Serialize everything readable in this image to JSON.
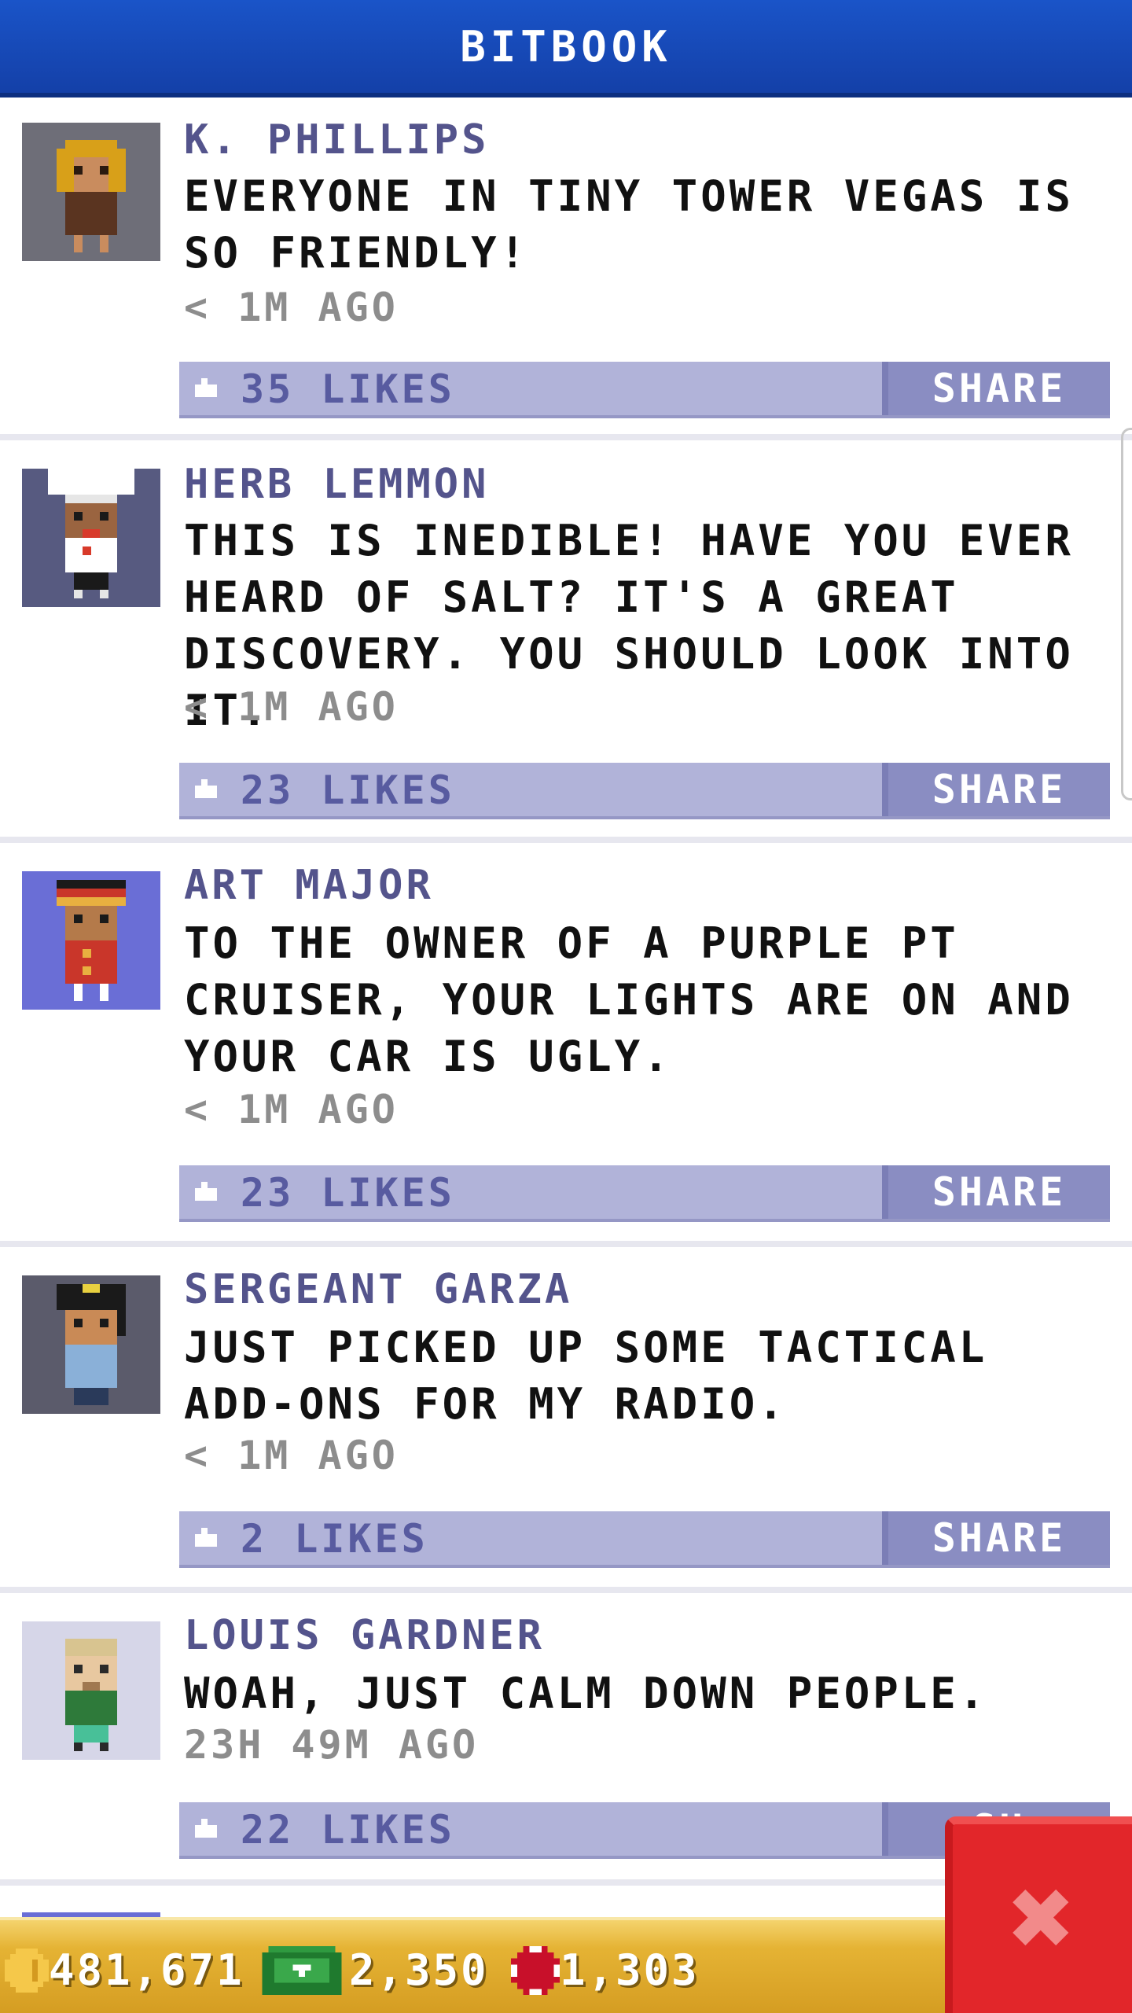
{
  "header": {
    "title": "BITBOOK"
  },
  "posts": [
    {
      "author": "K. PHILLIPS",
      "message": "EVERYONE IN TINY TOWER VEGAS IS SO FRIENDLY!",
      "time": "< 1M AGO",
      "likes": "35 LIKES",
      "share": "SHARE",
      "avatar_bg": "#6e6e78"
    },
    {
      "author": "HERB LEMMON",
      "message": "THIS IS INEDIBLE! HAVE YOU EVER HEARD OF SALT? IT'S A GREAT DISCOVERY. YOU SHOULD LOOK INTO IT.",
      "time": "< 1M AGO",
      "likes": "23 LIKES",
      "share": "SHARE",
      "avatar_bg": "#575a80"
    },
    {
      "author": "ART MAJOR",
      "message": "TO THE OWNER OF A PURPLE PT CRUISER, YOUR LIGHTS ARE ON AND YOUR CAR IS UGLY.",
      "time": "< 1M AGO",
      "likes": "23 LIKES",
      "share": "SHARE",
      "avatar_bg": "#6a6ed6"
    },
    {
      "author": "SERGEANT GARZA",
      "message": "JUST PICKED UP SOME TACTICAL ADD-ONS FOR MY RADIO.",
      "time": "< 1M AGO",
      "likes": "2 LIKES",
      "share": "SHARE",
      "avatar_bg": "#5b5b6b"
    },
    {
      "author": "LOUIS GARDNER",
      "message": "WOAH, JUST CALM DOWN PEOPLE.",
      "time": "23H 49M AGO",
      "likes": "22 LIKES",
      "share": "SH",
      "avatar_bg": "#d6d6e8"
    }
  ],
  "bottom_bar": {
    "coins": "481,671",
    "bux": "2,350",
    "chips": "1,303"
  },
  "icons": {
    "coin": "coin-icon",
    "bux": "bux-icon",
    "chip": "chip-icon",
    "close": "close-icon",
    "like": "like-icon"
  },
  "colors": {
    "header": "#1a54c8",
    "likebar": "#b1b3d9",
    "share": "#8a8dc2",
    "close": "#e2262a"
  }
}
